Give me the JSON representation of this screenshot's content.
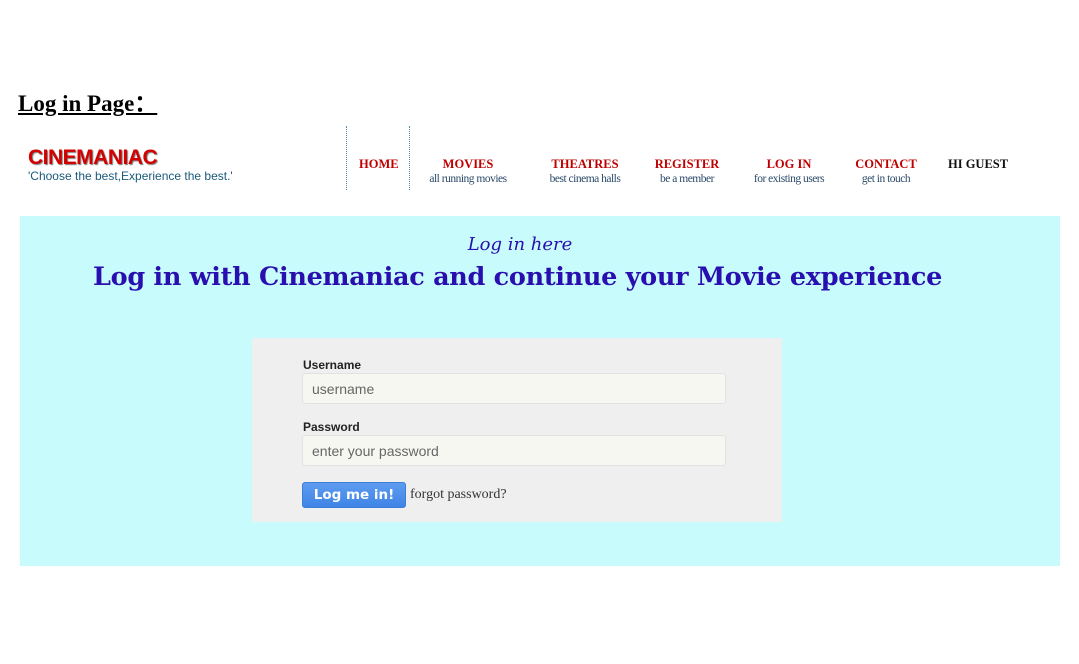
{
  "page": {
    "heading": "Log in Page："
  },
  "header": {
    "brand_name": "CINEMANIAC",
    "brand_tagline": "'Choose the best,Experience the best.'",
    "nav": [
      {
        "label": "HOME",
        "sub": ""
      },
      {
        "label": "MOVIES",
        "sub": "all running movies"
      },
      {
        "label": "THEATRES",
        "sub": "best cinema halls"
      },
      {
        "label": "REGISTER",
        "sub": "be a member"
      },
      {
        "label": "LOG IN",
        "sub": "for existing users"
      },
      {
        "label": "CONTACT",
        "sub": "get in touch"
      }
    ],
    "greeting": "HI GUEST"
  },
  "main": {
    "subtitle": "Log in here",
    "title": "Log in with Cinemaniac and continue your Movie experience",
    "form": {
      "username_label": "Username",
      "username_placeholder": "username",
      "password_label": "Password",
      "password_placeholder": "enter your password",
      "submit_label": "Log me in!",
      "forgot_label": "forgot password?"
    }
  },
  "colors": {
    "brand": "#d40000",
    "nav_label": "#c00000",
    "panel_background": "#c8fcfc",
    "title_text": "#2a0fb0",
    "button": "#4a8ae8"
  }
}
